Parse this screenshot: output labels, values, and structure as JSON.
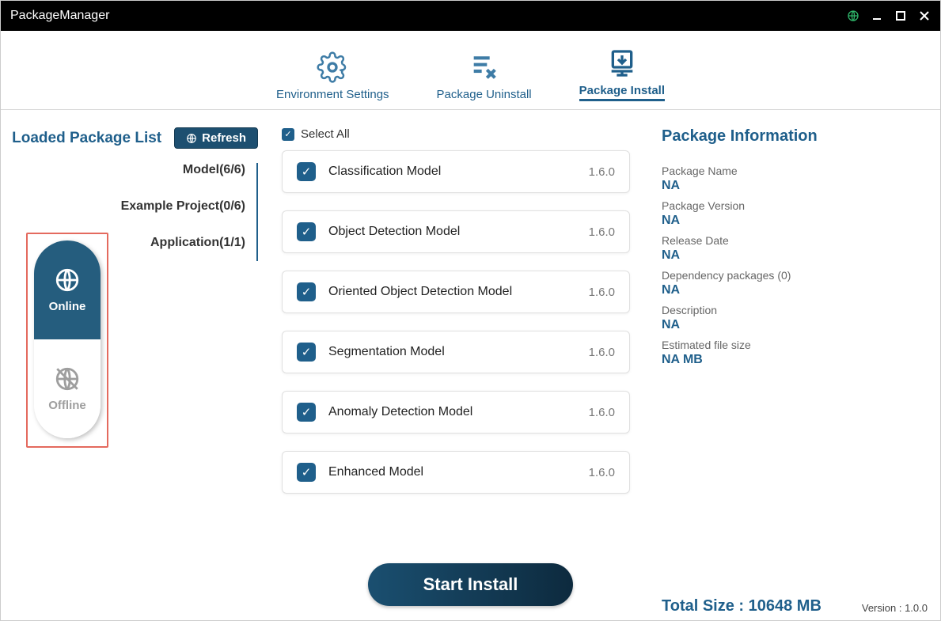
{
  "window": {
    "title": "PackageManager"
  },
  "tabs": {
    "env": "Environment Settings",
    "uninstall": "Package Uninstall",
    "install": "Package Install"
  },
  "mode": {
    "online": "Online",
    "offline": "Offline"
  },
  "leftcol": {
    "heading": "Loaded Package List",
    "refresh": "Refresh",
    "categories": [
      {
        "label": "Model(6/6)"
      },
      {
        "label": "Example Project(0/6)"
      },
      {
        "label": "Application(1/1)"
      }
    ]
  },
  "selectAll": "Select All",
  "packages": [
    {
      "name": "Classification Model",
      "version": "1.6.0"
    },
    {
      "name": "Object Detection Model",
      "version": "1.6.0"
    },
    {
      "name": "Oriented Object Detection Model",
      "version": "1.6.0"
    },
    {
      "name": "Segmentation Model",
      "version": "1.6.0"
    },
    {
      "name": "Anomaly Detection Model",
      "version": "1.6.0"
    },
    {
      "name": "Enhanced Model",
      "version": "1.6.0"
    }
  ],
  "info": {
    "heading": "Package Information",
    "name_label": "Package Name",
    "name_val": "NA",
    "ver_label": "Package Version",
    "ver_val": "NA",
    "date_label": "Release Date",
    "date_val": "NA",
    "dep_label": "Dependency packages (0)",
    "dep_val": "NA",
    "desc_label": "Description",
    "desc_val": "NA",
    "size_label": "Estimated file size",
    "size_val": "NA MB",
    "total": "Total Size : 10648 MB"
  },
  "startInstall": "Start Install",
  "versionText": "Version : 1.0.0"
}
